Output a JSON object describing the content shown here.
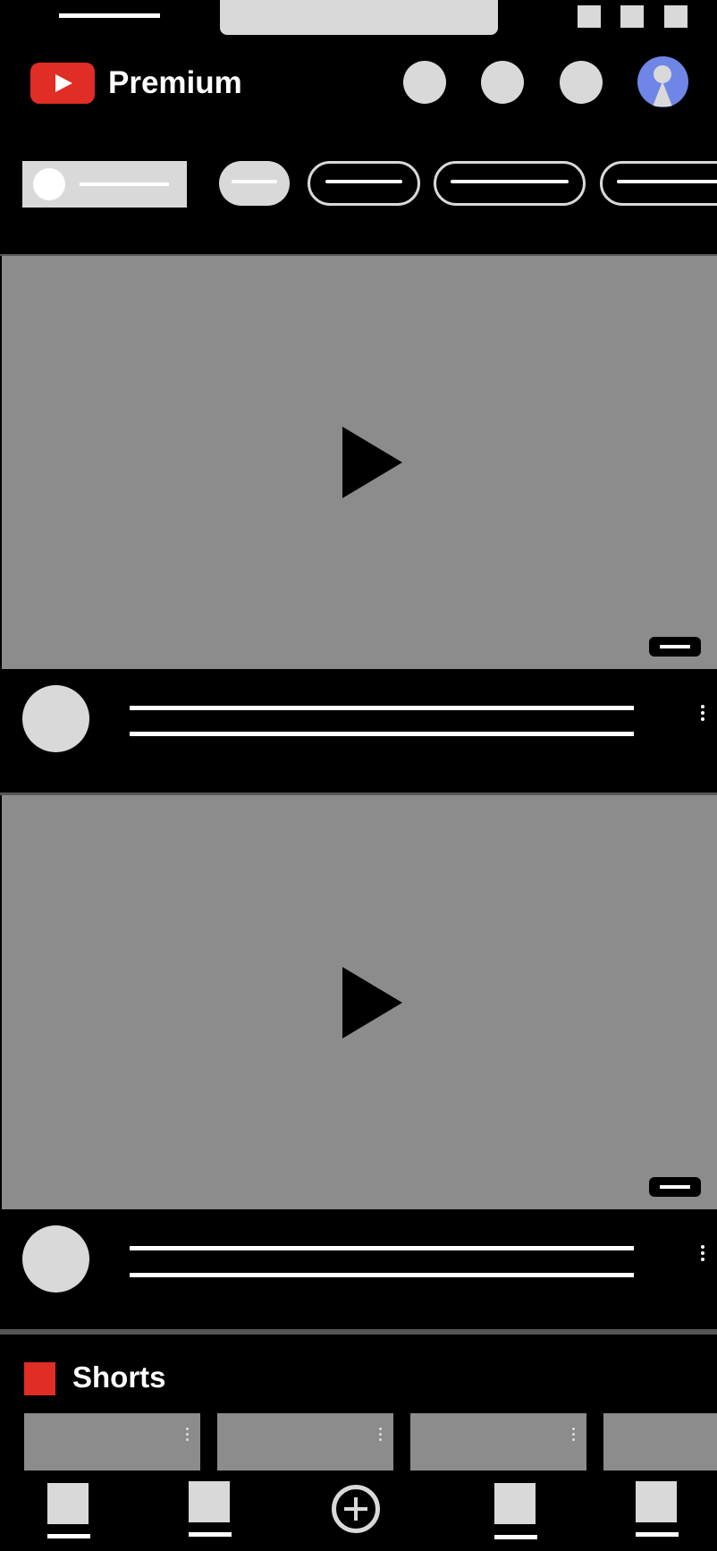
{
  "header": {
    "brand_label": "Premium",
    "logo_color": "#e02d25",
    "avatar_color": "#6f86e6"
  },
  "sections": {
    "shorts_title": "Shorts",
    "shorts_icon_color": "#e02d25"
  },
  "icons": {
    "status_icons": [
      "status-icon",
      "status-icon",
      "status-icon"
    ],
    "header_actions": [
      "cast-icon",
      "notifications-icon",
      "search-icon"
    ],
    "nav": [
      "home-icon",
      "shorts-icon",
      "create-icon",
      "subscriptions-icon",
      "library-icon"
    ]
  }
}
